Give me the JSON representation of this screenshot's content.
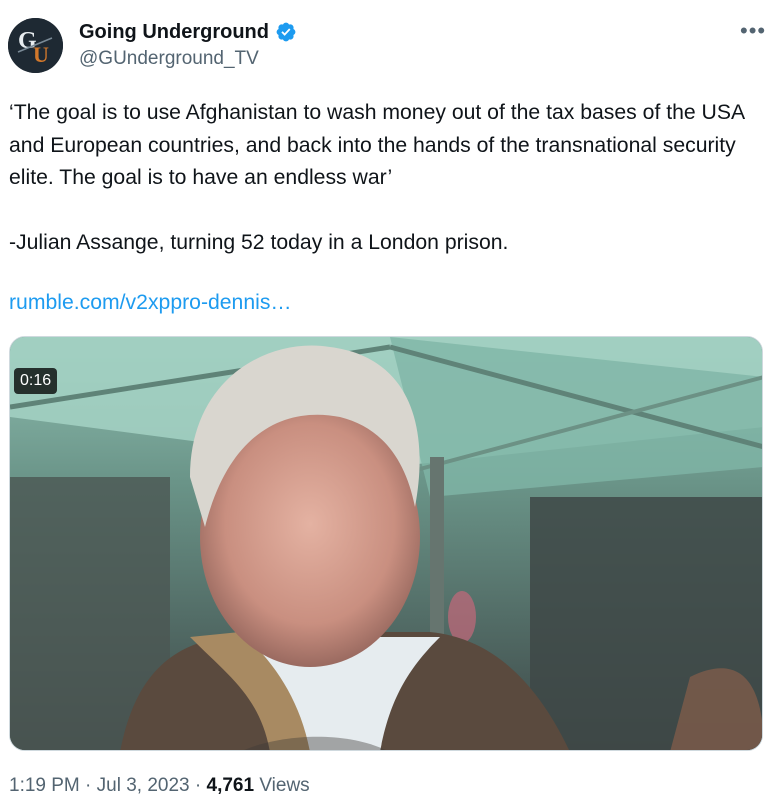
{
  "author": {
    "display_name": "Going Underground",
    "handle": "@GUnderground_TV",
    "avatar_letters": "GU"
  },
  "more_icon": "more-horizontal-icon",
  "tweet": {
    "text": "‘The goal is to use Afghanistan to wash money out of the tax bases of the USA and European countries, and back into the hands of the transnational security elite. The goal is to have an endless war’\n\n-Julian Assange, turning 52 today in a London prison.",
    "link": "rumble.com/v2xppro-dennis…"
  },
  "media": {
    "duration": "0:16"
  },
  "meta": {
    "time": "1:19 PM",
    "separator": " · ",
    "date": "Jul 3, 2023",
    "views_count": "4,761",
    "views_label": "Views"
  },
  "colors": {
    "link": "#1d9bf0",
    "verified": "#1d9bf0",
    "secondary_text": "#536471"
  }
}
